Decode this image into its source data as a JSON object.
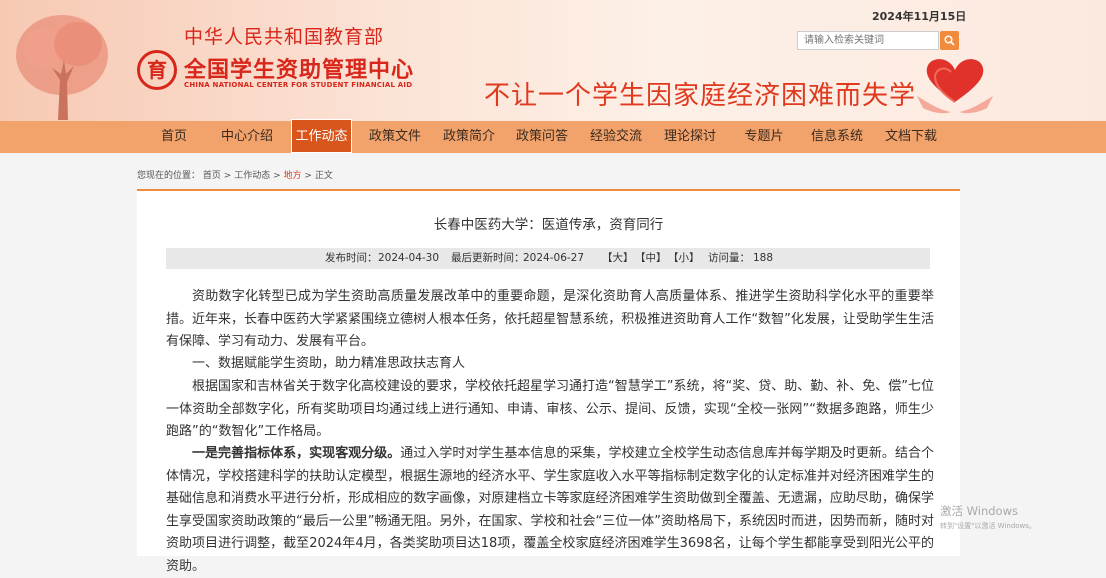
{
  "header": {
    "ministry": "中华人民共和国教育部",
    "center_cn": "全国学生资助管理中心",
    "center_en": "CHINA NATIONAL CENTER FOR STUDENT FINANCIAL AID",
    "logo_char": "育",
    "slogan": "不让一个学生因家庭经济困难而失学",
    "date": "2024年11月15日",
    "search_placeholder": "请输入检索关键词"
  },
  "nav": {
    "items": [
      "首页",
      "中心介绍",
      "工作动态",
      "政策文件",
      "政策简介",
      "政策问答",
      "经验交流",
      "理论探讨",
      "专题片",
      "信息系统",
      "文档下载"
    ],
    "active": "工作动态"
  },
  "breadcrumb": {
    "prefix": "您现在的位置：",
    "items": [
      "首页",
      "工作动态",
      "地方",
      "正文"
    ],
    "sep": ">"
  },
  "article": {
    "title": "长春中医药大学：医道传承，资育同行",
    "meta": {
      "published_label": "发布时间：",
      "published": "2024-04-30",
      "updated_label": "最后更新时间：",
      "updated": "2024-06-27",
      "size_large": "【大】",
      "size_medium": "【中】",
      "size_small": "【小】",
      "views_label": "访问量：",
      "views": "188"
    },
    "p1": "资助数字化转型已成为学生资助高质量发展改革中的重要命题，是深化资助育人高质量体系、推进学生资助科学化水平的重要举措。近年来，长春中医药大学紧紧围绕立德树人根本任务，依托超星智慧系统，积极推进资助育人工作“数智”化发展，让受助学生生活有保障、学习有动力、发展有平台。",
    "p2": "一、数据赋能学生资助，助力精准思政扶志育人",
    "p3": "根据国家和吉林省关于数字化高校建设的要求，学校依托超星学习通打造“智慧学工”系统，将“奖、贷、助、勤、补、免、偿”七位一体资助全部数字化，所有奖助项目均通过线上进行通知、申请、审核、公示、提间、反馈，实现“全校一张网”“数据多跑路，师生少跑路”的“数智化”工作格局。",
    "p4_bold": "一是完善指标体系，实现客观分级。",
    "p4": "通过入学时对学生基本信息的采集，学校建立全校学生动态信息库并每学期及时更新。结合个体情况，学校搭建科学的扶助认定模型，根据生源地的经济水平、学生家庭收入水平等指标制定数字化的认定标准并对经济困难学生的基础信息和消费水平进行分析，形成相应的数字画像，对原建档立卡等家庭经济困难学生资助做到全覆盖、无遗漏，应助尽助，确保学生享受国家资助政策的“最后一公里”畅通无阻。另外，在国家、学校和社会“三位一体”资助格局下，系统因时而进，因势而新，随时对资助项目进行调整，截至2024年4月，各类奖助项目达18项，覆盖全校家庭经济困难学生3698名，让每个学生都能享受到阳光公平的资助。"
  },
  "watermark": {
    "line1": "激活 Windows",
    "line2": "转到\"设置\"以激活 Windows。"
  },
  "colors": {
    "brand_red": "#d8261b",
    "nav_bg": "#f2a36c",
    "nav_active": "#d8561c",
    "accent_orange": "#f08a3c"
  }
}
